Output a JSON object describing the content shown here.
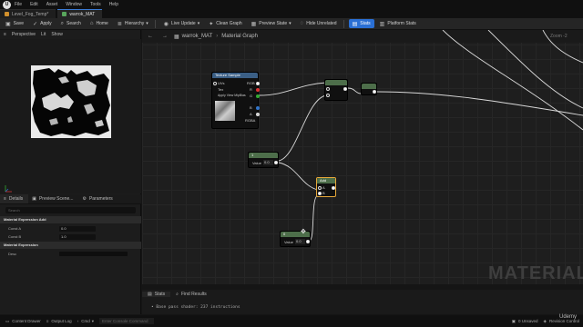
{
  "menubar": {
    "logo": "U",
    "items": [
      "File",
      "Edit",
      "Asset",
      "Window",
      "Tools",
      "Help"
    ]
  },
  "doc_tabs": [
    {
      "label": "Level_Fog_Temp*",
      "color": "#d08f2c"
    },
    {
      "label": "warrok_MAT",
      "color": "#58a65c"
    }
  ],
  "toolbar": {
    "save": "Save",
    "apply": "Apply",
    "search": "Search",
    "home": "Home",
    "hierarchy": "Hierarchy",
    "live_update": "Live Update",
    "clean_graph": "Clean Graph",
    "preview_state": "Preview State",
    "hide_unrelated": "Hide Unrelated",
    "stats": "Stats",
    "platform_stats": "Platform Stats"
  },
  "viewport": {
    "perspective": "Perspective",
    "lit": "Lit",
    "show": "Show"
  },
  "panel_tabs": {
    "details": "Details",
    "preview_scene": "Preview Scene...",
    "parameters": "Parameters"
  },
  "details": {
    "search_placeholder": "Search",
    "section1": "Material Expression Add",
    "const_a_label": "Const A",
    "const_a": "0.0",
    "const_b_label": "Const B",
    "const_b": "1.0",
    "section2": "Material Expression",
    "desc_label": "Desc"
  },
  "graph": {
    "title": "warrok_MAT",
    "breadcrumb": "Material Graph",
    "zoom": "Zoom -2",
    "watermark": "MATERIAL"
  },
  "nodes": {
    "texture": {
      "title": "Texture Sample",
      "in_uvs": "UVs",
      "in_tex": "Tex",
      "in_mip": "Apply View MipBias",
      "out_rgb": "RGB",
      "out_r": "R",
      "out_g": "G",
      "out_b": "B",
      "out_a": "A",
      "out_rgba": "RGBA"
    },
    "const1": {
      "title": "1",
      "value_label": "Value",
      "value": "0.0"
    },
    "const2": {
      "title": "0",
      "value_label": "Value",
      "value": "0.0"
    },
    "add": {
      "title": "Add",
      "a": "A",
      "b": "B"
    }
  },
  "stats": {
    "tab": "Stats",
    "find": "Find Results",
    "line": "• Base pass shader: 237 instructions"
  },
  "statusbar": {
    "content_drawer": "Content Drawer",
    "output_log": "Output Log",
    "cmd": "Cmd",
    "cmd_placeholder": "Enter Console Command",
    "unsaved": "0 Unsaved",
    "revision": "Revision Control"
  },
  "udemy": "Udemy",
  "colors": {
    "accent": "#2a6fd4",
    "node_green": "#4d6e4a",
    "node_gold": "#e8a93a"
  }
}
